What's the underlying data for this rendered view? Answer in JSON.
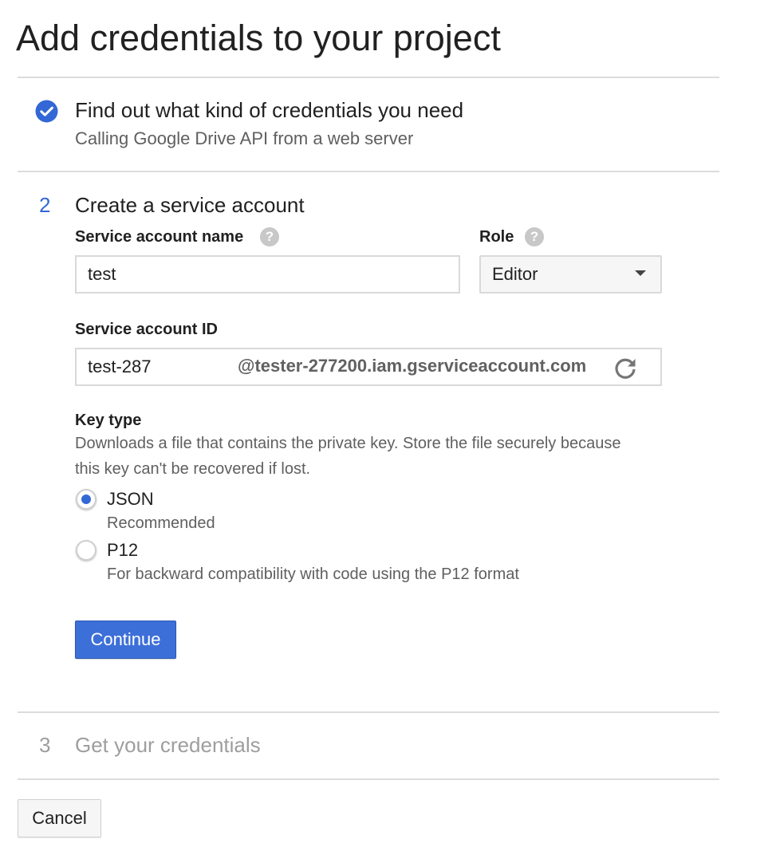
{
  "page": {
    "title": "Add credentials to your project"
  },
  "step1": {
    "title": "Find out what kind of credentials you need",
    "subtitle": "Calling Google Drive API from a web server",
    "status_icon": "check-circle-icon"
  },
  "step2": {
    "number": "2",
    "title": "Create a service account",
    "service_account_name": {
      "label": "Service account name",
      "value": "test",
      "help_icon": "question-circle-icon"
    },
    "role": {
      "label": "Role",
      "selected": "Editor",
      "help_icon": "question-circle-icon"
    },
    "service_account_id": {
      "label": "Service account ID",
      "value": "test-287",
      "suffix": "@tester-277200.iam.gserviceaccount.com",
      "refresh_icon": "refresh-icon"
    },
    "key_type": {
      "label": "Key type",
      "description": "Downloads a file that contains the private key. Store the file securely because this key can't be recovered if lost.",
      "options": [
        {
          "label": "JSON",
          "sublabel": "Recommended",
          "checked": true
        },
        {
          "label": "P12",
          "sublabel": "For backward compatibility with code using the P12 format",
          "checked": false
        }
      ]
    },
    "continue_label": "Continue"
  },
  "step3": {
    "number": "3",
    "title": "Get your credentials"
  },
  "footer": {
    "cancel_label": "Cancel"
  },
  "colors": {
    "accent": "#3367d6",
    "divider": "#dcdcdc",
    "muted_text": "#9e9e9e",
    "secondary_text": "#5f5f5f"
  }
}
